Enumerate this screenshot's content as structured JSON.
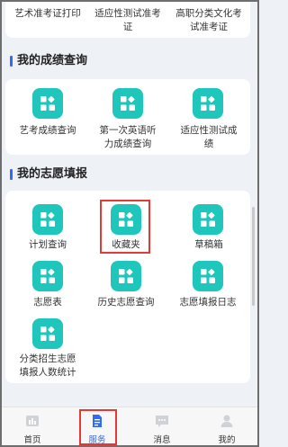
{
  "top_items": [
    {
      "label": "艺术准考证打印"
    },
    {
      "label": "适应性测试准考证"
    },
    {
      "label": "高职分类文化考试准考证"
    }
  ],
  "sections": [
    {
      "title": "我的成绩查询",
      "items": [
        {
          "label": "艺考成绩查询"
        },
        {
          "label": "第一次英语听力成绩查询"
        },
        {
          "label": "适应性测试成绩"
        }
      ]
    },
    {
      "title": "我的志愿填报",
      "items": [
        {
          "label": "计划查询"
        },
        {
          "label": "收藏夹",
          "highlighted": true
        },
        {
          "label": "草稿箱"
        },
        {
          "label": "志愿表"
        },
        {
          "label": "历史志愿查询"
        },
        {
          "label": "志愿填报日志"
        },
        {
          "label": "分类招生志愿填报人数统计"
        }
      ]
    }
  ],
  "tabbar": [
    {
      "label": "首页",
      "icon": "home-icon"
    },
    {
      "label": "服务",
      "icon": "service-doc-icon",
      "active": true
    },
    {
      "label": "消息",
      "icon": "message-icon"
    },
    {
      "label": "我的",
      "icon": "user-icon"
    }
  ],
  "colors": {
    "tile": "#1fc6bb",
    "accent": "#2f6cf5",
    "highlight": "#e53935"
  }
}
